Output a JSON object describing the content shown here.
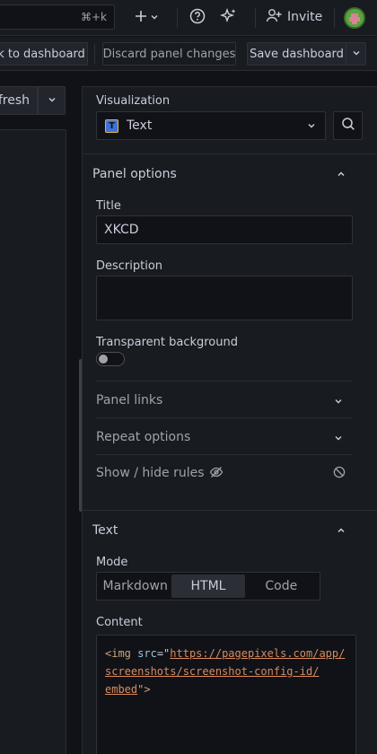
{
  "topbar": {
    "search_shortcut": "⌘+k",
    "invite_label": "Invite"
  },
  "toolbar": {
    "back_label": "k to dashboard",
    "discard_label": "Discard panel changes",
    "save_label": "Save dashboard"
  },
  "left": {
    "refresh_label": "fresh"
  },
  "visualization": {
    "label": "Visualization",
    "selected": "Text",
    "icon_letter": "T"
  },
  "panel_options": {
    "header": "Panel options",
    "title_label": "Title",
    "title_value": "XKCD",
    "description_label": "Description",
    "description_value": "",
    "transparent_label": "Transparent background",
    "transparent_on": false,
    "panel_links": "Panel links",
    "repeat_options": "Repeat options",
    "show_hide_rules": "Show / hide rules"
  },
  "text_section": {
    "header": "Text",
    "mode_label": "Mode",
    "modes": [
      "Markdown",
      "HTML",
      "Code"
    ],
    "active_mode": "HTML",
    "content_label": "Content",
    "content": {
      "tag_open": "<img",
      "attr": "src",
      "eq": "=\"",
      "url_line1": "https://pagepixels.com/app/",
      "url_line2": "screenshots/screenshot-config-id/",
      "url_line3": "embed",
      "tag_close": "\">"
    }
  },
  "colors": {
    "background": "#111217",
    "panel": "#181b1f",
    "border": "#2f3239",
    "text": "#ccccdc",
    "muted": "#9fa2ab"
  }
}
